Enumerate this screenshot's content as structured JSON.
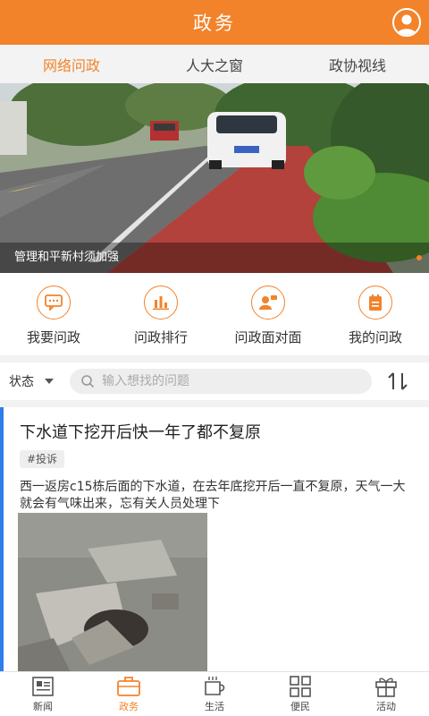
{
  "header": {
    "title": "政务"
  },
  "tabs": [
    {
      "label": "网络问政"
    },
    {
      "label": "人大之窗"
    },
    {
      "label": "政协视线"
    }
  ],
  "banner": {
    "caption": "管理和平新村须加强"
  },
  "quick": [
    {
      "label": "我要问政",
      "icon": "chat-bubble-icon"
    },
    {
      "label": "问政排行",
      "icon": "bar-chart-icon"
    },
    {
      "label": "问政面对面",
      "icon": "people-talk-icon"
    },
    {
      "label": "我的问政",
      "icon": "notepad-icon"
    }
  ],
  "filter": {
    "status_label": "状态",
    "search_placeholder": "输入想找的问题"
  },
  "post": {
    "title": "下水道下挖开后快一年了都不复原",
    "tag": "#投诉",
    "body": "西一返房c15栋后面的下水道，在去年底挖开后一直不复原，天气一大就会有气味出来，忘有关人员处理下"
  },
  "bottom_nav": [
    {
      "label": "新闻",
      "icon": "newspaper-icon"
    },
    {
      "label": "政务",
      "icon": "briefcase-icon"
    },
    {
      "label": "生活",
      "icon": "cup-icon"
    },
    {
      "label": "便民",
      "icon": "grid-icon"
    },
    {
      "label": "活动",
      "icon": "gift-icon"
    }
  ],
  "colors": {
    "accent": "#f2832b",
    "post_accent": "#2e7de9"
  }
}
